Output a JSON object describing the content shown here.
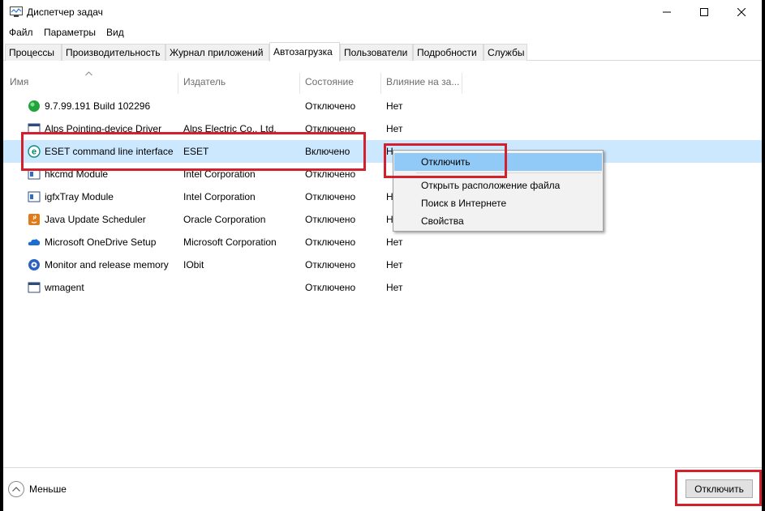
{
  "window": {
    "title": "Диспетчер задач"
  },
  "menu": [
    "Файл",
    "Параметры",
    "Вид"
  ],
  "tabs": [
    "Процессы",
    "Производительность",
    "Журнал приложений",
    "Автозагрузка",
    "Пользователи",
    "Подробности",
    "Службы"
  ],
  "active_tab": "Автозагрузка",
  "columns": {
    "name": "Имя",
    "publisher": "Издатель",
    "status": "Состояние",
    "impact": "Влияние на за..."
  },
  "rows": [
    {
      "name": "9.7.99.191 Build 102296",
      "publisher": "",
      "status": "Отключено",
      "impact": "Нет",
      "icon": "green-circle-icon"
    },
    {
      "name": "Alps Pointing-device Driver",
      "publisher": "Alps Electric Co., Ltd.",
      "status": "Отключено",
      "impact": "Нет",
      "icon": "window-icon"
    },
    {
      "name": "ESET command line interface",
      "publisher": "ESET",
      "status": "Включено",
      "impact": "Н",
      "icon": "eset-icon"
    },
    {
      "name": "hkcmd Module",
      "publisher": "Intel Corporation",
      "status": "Отключено",
      "impact": "",
      "icon": "module-icon"
    },
    {
      "name": "igfxTray Module",
      "publisher": "Intel Corporation",
      "status": "Отключено",
      "impact": "Н",
      "icon": "module-icon"
    },
    {
      "name": "Java Update Scheduler",
      "publisher": "Oracle Corporation",
      "status": "Отключено",
      "impact": "Н",
      "icon": "java-icon"
    },
    {
      "name": "Microsoft OneDrive Setup",
      "publisher": "Microsoft Corporation",
      "status": "Отключено",
      "impact": "Нет",
      "icon": "cloud-icon"
    },
    {
      "name": "Monitor and release memory",
      "publisher": "IObit",
      "status": "Отключено",
      "impact": "Нет",
      "icon": "memory-icon"
    },
    {
      "name": "wmagent",
      "publisher": "",
      "status": "Отключено",
      "impact": "Нет",
      "icon": "window-icon"
    }
  ],
  "context_menu": [
    "Отключить",
    "Открыть расположение файла",
    "Поиск в Интернете",
    "Свойства"
  ],
  "footer": {
    "less_label": "Меньше",
    "disable_button": "Отключить"
  },
  "colors": {
    "selection": "#cce8ff",
    "highlight_box": "#d4202c",
    "menu_hover": "#91c9f7"
  }
}
